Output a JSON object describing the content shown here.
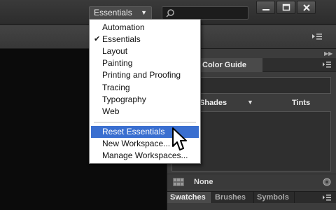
{
  "app_bar": {
    "workspace_label": "Essentials",
    "caret_icon": "chevron-down-icon",
    "search_placeholder": "",
    "window_buttons": [
      "minimize-icon",
      "maximize-icon",
      "close-icon"
    ]
  },
  "workspace_menu": {
    "items": [
      {
        "label": "Automation",
        "checked": false
      },
      {
        "label": "Essentials",
        "checked": true
      },
      {
        "label": "Layout",
        "checked": false
      },
      {
        "label": "Painting",
        "checked": false
      },
      {
        "label": "Printing and Proofing",
        "checked": false
      },
      {
        "label": "Tracing",
        "checked": false
      },
      {
        "label": "Typography",
        "checked": false
      },
      {
        "label": "Web",
        "checked": false
      }
    ],
    "actions": [
      {
        "label": "Reset Essentials",
        "highlighted": true
      },
      {
        "label": "New Workspace...",
        "highlighted": false
      },
      {
        "label": "Manage Workspaces...",
        "highlighted": false
      }
    ],
    "check_glyph": "✔",
    "highlight_color": "#3a6fd0"
  },
  "color_guide": {
    "tab_label": "Color Guide",
    "shades_label": "Shades",
    "tints_label": "Tints",
    "swatch_group_label": "None"
  },
  "bottom_panel": {
    "tabs": [
      "Swatches",
      "Brushes",
      "Symbols"
    ],
    "active_tab": "Swatches"
  },
  "colors": {
    "canvas": "#0b0b0b",
    "panel": "#3c3c3c",
    "menu_bg": "#ffffff"
  }
}
